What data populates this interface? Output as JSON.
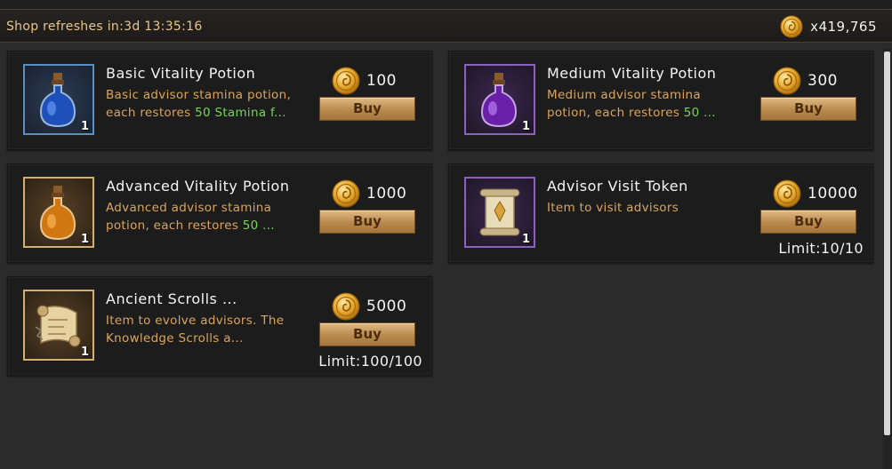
{
  "header": {
    "refresh_text": "Shop refreshes in:3d 13:35:16",
    "balance": "x419,765"
  },
  "items": [
    {
      "name": "Basic Vitality Potion",
      "desc_line1": "Basic advisor stamina potion,",
      "desc_line2_pre": "each restores ",
      "desc_line2_highlight": "50 Stamina f...",
      "quantity": "1",
      "price": "100",
      "buy_label": "Buy",
      "icon": "blue-potion-icon"
    },
    {
      "name": "Medium Vitality Potion",
      "desc_line1": "Medium advisor stamina",
      "desc_line2_pre": "potion, each restores ",
      "desc_line2_highlight": "50 ...",
      "quantity": "1",
      "price": "300",
      "buy_label": "Buy",
      "icon": "purple-potion-icon"
    },
    {
      "name": "Advanced Vitality Potion",
      "desc_line1": "Advanced advisor stamina",
      "desc_line2_pre": "potion, each restores ",
      "desc_line2_highlight": "50 ...",
      "quantity": "1",
      "price": "1000",
      "buy_label": "Buy",
      "icon": "orange-potion-icon"
    },
    {
      "name": "Advisor Visit Token",
      "desc_line1": "Item to visit advisors",
      "quantity": "1",
      "price": "10000",
      "buy_label": "Buy",
      "limit": "Limit:10/10",
      "icon": "scroll-token-icon"
    },
    {
      "name": "Ancient Scrolls ...",
      "desc_line1": "Item to evolve advisors. The",
      "desc_line2": "Knowledge Scrolls a...",
      "quantity": "1",
      "price": "5000",
      "buy_label": "Buy",
      "limit": "Limit:100/100",
      "icon": "ancient-scroll-icon"
    }
  ],
  "colors": {
    "desc": "#d9a55e",
    "highlight": "#78d45a",
    "gold_border": "#c9a66a",
    "blue_border": "#5a8fc4",
    "purple_border": "#8c62c0"
  }
}
